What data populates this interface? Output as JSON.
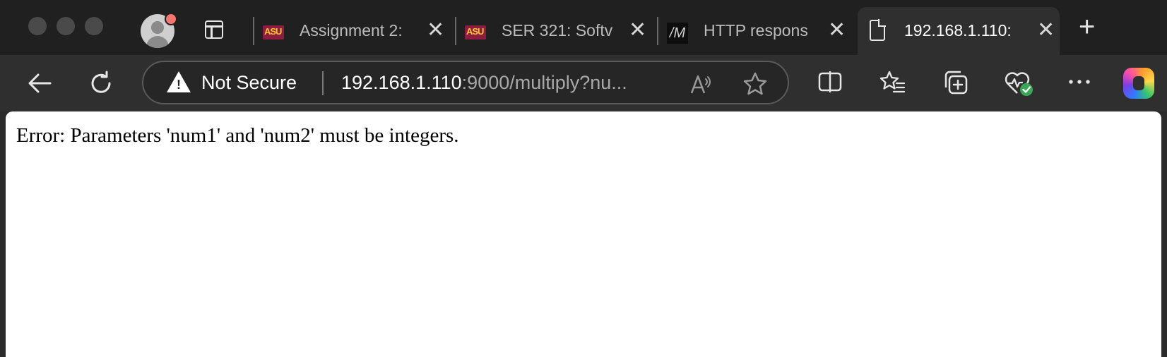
{
  "tabs": [
    {
      "label": "Assignment 2:",
      "icon": "asu-logo-icon",
      "icon_text": "ASU"
    },
    {
      "label": "SER 321: Softv",
      "icon": "asu-logo-icon",
      "icon_text": "ASU"
    },
    {
      "label": "HTTP respons",
      "icon": "m-logo-icon",
      "icon_text": "/M"
    },
    {
      "label": "192.168.1.110:",
      "icon": "document-icon",
      "active": true
    }
  ],
  "address": {
    "security_label": "Not Secure",
    "host": "192.168.1.110",
    "path": ":9000/multiply?nu..."
  },
  "page": {
    "text": "Error: Parameters 'num1' and 'num2' must be integers."
  },
  "colors": {
    "asu_maroon": "#8c1d40",
    "asu_gold": "#ffc627",
    "notification_dot": "#f4766f",
    "health_check": "#3aa757"
  }
}
